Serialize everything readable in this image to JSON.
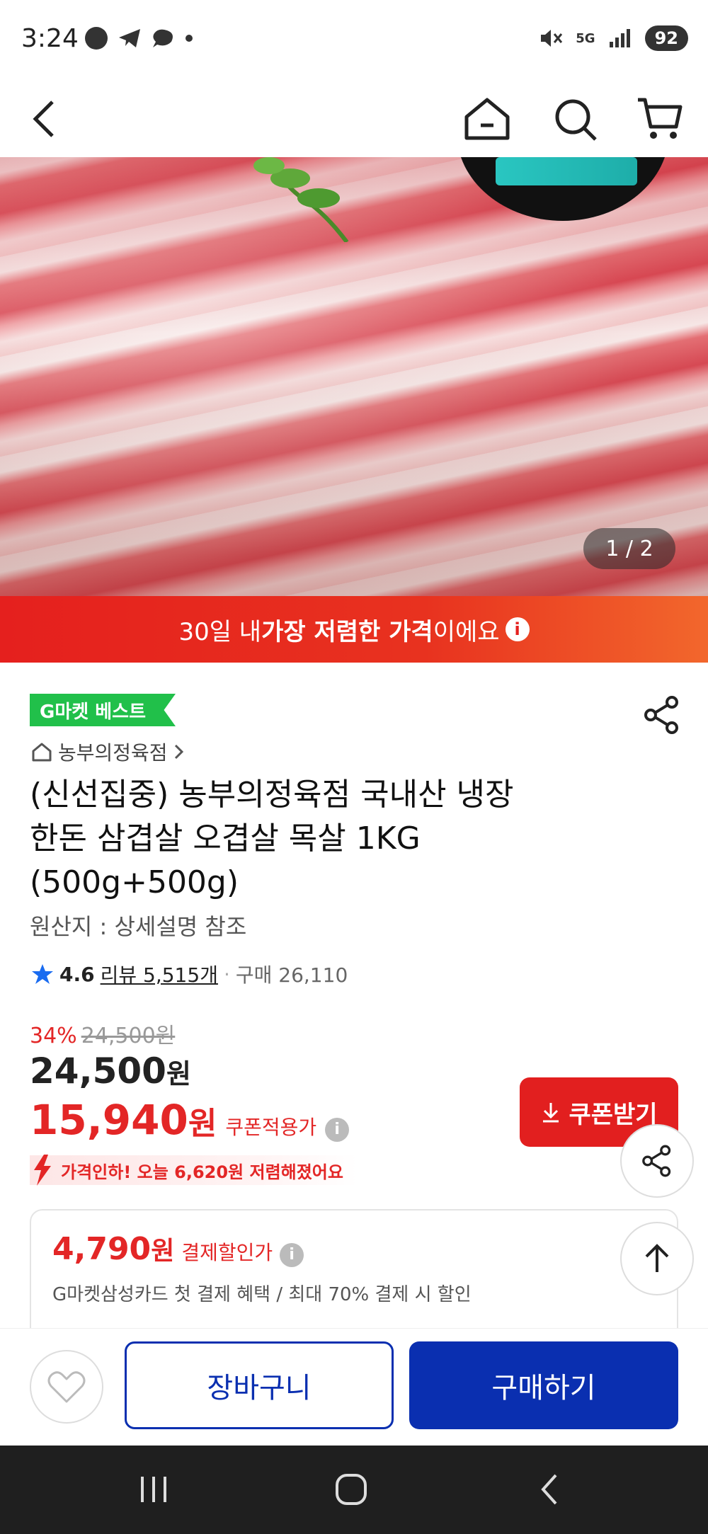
{
  "status_bar": {
    "time": "3:24",
    "network": "5G",
    "battery": "92"
  },
  "header": {
    "back": "back",
    "home": "home",
    "search": "search",
    "cart": "cart"
  },
  "hero": {
    "counter": "1 / 2"
  },
  "banner": {
    "prefix": "30일 내 ",
    "bold": "가장 저렴한 가격",
    "suffix": "이에요",
    "info": "i"
  },
  "product": {
    "badge": "G마켓 베스트",
    "store": "농부의정육점",
    "title_lines": [
      "(신선집중) 농부의정육점 국내산 냉장",
      "한돈 삼겹살 오겹살 목살 1KG",
      "(500g+500g)"
    ],
    "origin": "원산지 : 상세설명 참조",
    "rating": "4.6",
    "reviews": "리뷰 5,515개",
    "purchases": "구매 26,110"
  },
  "pricing": {
    "discount_rate": "34%",
    "original_price": "24,500원",
    "price_num": "24,500",
    "price_unit": "원",
    "coupon_price_num": "15,940",
    "coupon_price_unit": "원",
    "coupon_label": "쿠폰적용가",
    "coupon_button": "쿠폰받기",
    "price_drop": "가격인하! 오늘 6,620원 저렴해졌어요"
  },
  "payment": {
    "price_num": "4,790",
    "price_unit": "원",
    "label": "결제할인가",
    "desc": "G마켓삼성카드 첫 결제 혜택 / 최대 70% 결제 시 할인"
  },
  "actions": {
    "cart": "장바구니",
    "buy": "구매하기"
  },
  "colors": {
    "accent_red": "#e32626",
    "brand_blue": "#0a2fb0",
    "badge_green": "#21c04a"
  }
}
